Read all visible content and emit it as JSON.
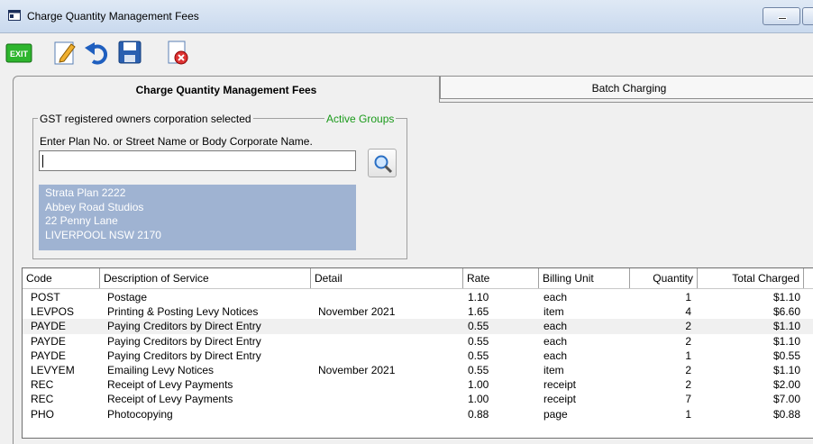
{
  "window": {
    "title": "Charge Quantity Management Fees"
  },
  "toolbar": {
    "exit_label": "EXIT",
    "buttons": [
      "exit-icon",
      "edit-icon",
      "undo-icon",
      "save-icon",
      "delete-document-icon"
    ]
  },
  "tabs": [
    {
      "label": "Charge Quantity Management Fees",
      "active": true
    },
    {
      "label": "Batch Charging",
      "active": false
    }
  ],
  "selection": {
    "group_title": "GST registered owners corporation selected",
    "active_groups_label": "Active Groups",
    "prompt": "Enter Plan No. or Street Name or Body Corporate Name.",
    "search_value": "",
    "address_lines": [
      "Strata Plan 2222",
      "Abbey Road Studios",
      "22 Penny Lane",
      "LIVERPOOL  NSW  2170"
    ]
  },
  "colors": {
    "active_groups": "#1a9a1a",
    "address_bg": "#9fb3d2",
    "row_alt": "#f0f0f0"
  },
  "table": {
    "columns": [
      "Code",
      "Description of Service",
      "Detail",
      "Rate",
      "Billing Unit",
      "Quantity",
      "Total Charged"
    ],
    "rows": [
      [
        "POST",
        "Postage",
        "",
        "1.10",
        "each",
        "1",
        "$1.10"
      ],
      [
        "LEVPOS",
        "Printing & Posting Levy Notices",
        "November 2021",
        "1.65",
        "item",
        "4",
        "$6.60"
      ],
      [
        "PAYDE",
        "Paying Creditors by Direct Entry",
        "",
        "0.55",
        "each",
        "2",
        "$1.10"
      ],
      [
        "PAYDE",
        "Paying Creditors by Direct Entry",
        "",
        "0.55",
        "each",
        "2",
        "$1.10"
      ],
      [
        "PAYDE",
        "Paying Creditors by Direct Entry",
        "",
        "0.55",
        "each",
        "1",
        "$0.55"
      ],
      [
        "LEVYEM",
        "Emailing Levy Notices",
        "November 2021",
        "0.55",
        "item",
        "2",
        "$1.10"
      ],
      [
        "REC",
        "Receipt of Levy Payments",
        "",
        "1.00",
        "receipt",
        "2",
        "$2.00"
      ],
      [
        "REC",
        "Receipt of Levy Payments",
        "",
        "1.00",
        "receipt",
        "7",
        "$7.00"
      ],
      [
        "PHO",
        "Photocopying",
        "",
        "0.88",
        "page",
        "1",
        "$0.88"
      ]
    ]
  }
}
